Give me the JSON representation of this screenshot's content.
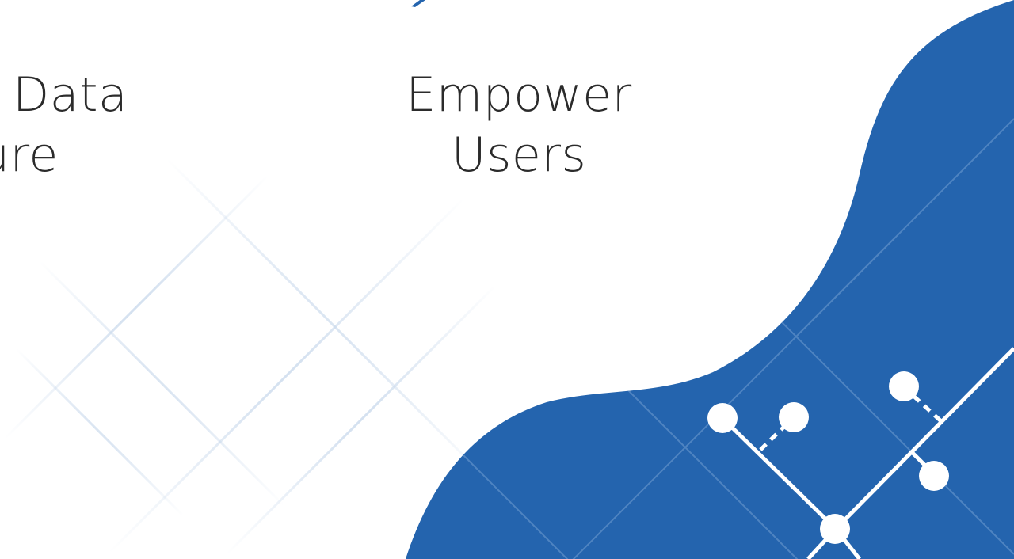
{
  "slide": {
    "left_heading": {
      "line1": "Data",
      "line2": "ure"
    },
    "center_heading": {
      "line1": "Empower",
      "line2": "Users"
    }
  },
  "colors": {
    "text": "#2b2b2b",
    "accent_blue": "#2464ae",
    "grid_line": "#dbe6f2",
    "network": "#ffffff"
  },
  "icons": [
    "network-node-icon"
  ]
}
